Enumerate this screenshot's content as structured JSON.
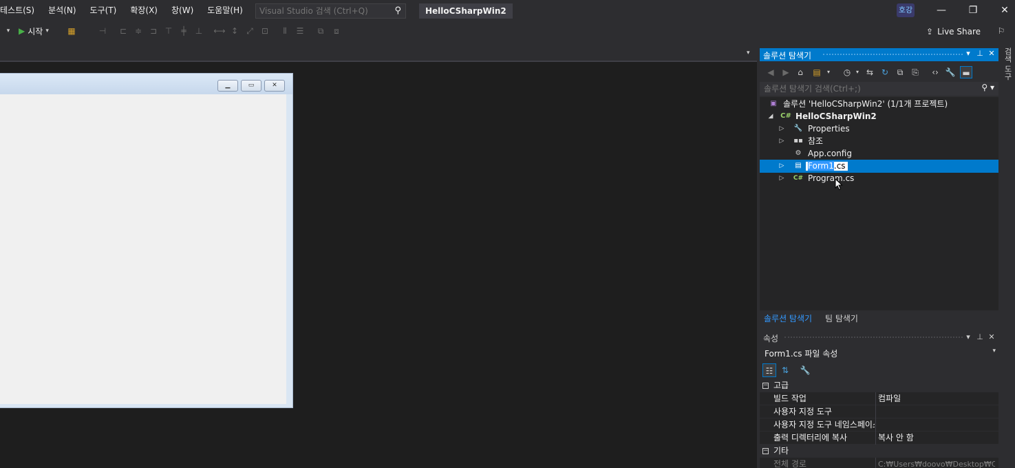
{
  "menu": {
    "items": [
      "테스트(S)",
      "분석(N)",
      "도구(T)",
      "확장(X)",
      "창(W)",
      "도움말(H)"
    ]
  },
  "search": {
    "placeholder": "Visual Studio 검색 (Ctrl+Q)"
  },
  "solution_title": "HelloCSharpWin2",
  "user_badge": "호강",
  "toolbar": {
    "start_label": "시작",
    "live_share": "Live Share"
  },
  "solution_explorer": {
    "title": "솔루션 탐색기",
    "search_placeholder": "솔루션 탐색기 검색(Ctrl+;)",
    "nodes": [
      {
        "label": "솔루션 'HelloCSharpWin2' (1/1개 프로젝트)"
      },
      {
        "label": "HelloCSharpWin2"
      },
      {
        "label": "Properties"
      },
      {
        "label": "참조"
      },
      {
        "label": "App.config"
      },
      {
        "label": "Form1.cs",
        "rename_selected": "Form1",
        "rename_rest": ".cs"
      },
      {
        "label": "Program.cs"
      }
    ],
    "tabs": [
      "솔루션 탐색기",
      "팀 탐색기"
    ]
  },
  "side_strip": "검색 도구",
  "properties": {
    "title": "속성",
    "object": "Form1.cs 파일 속성",
    "categories": [
      {
        "name": "고급",
        "rows": [
          {
            "key": "빌드 작업",
            "value": "컴파일"
          },
          {
            "key": "사용자 지정 도구",
            "value": ""
          },
          {
            "key": "사용자 지정 도구 네임스페이스",
            "value": ""
          },
          {
            "key": "출력 디렉터리에 복사",
            "value": "복사 안 함"
          }
        ]
      },
      {
        "name": "기타",
        "rows": [
          {
            "key": "전체 경로",
            "value": "C:₩Users₩doovo₩Desktop₩C#"
          }
        ]
      }
    ]
  },
  "colors": {
    "accent": "#007acc",
    "background": "#1e1e1e",
    "chrome": "#2d2d30"
  }
}
